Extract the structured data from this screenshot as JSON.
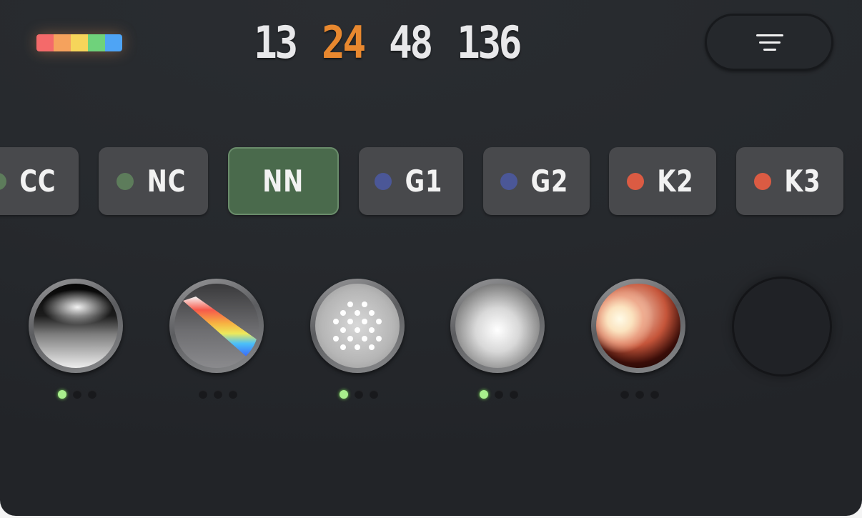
{
  "colors": {
    "accent": "#e8882f",
    "active_chip": "#4a6a4c",
    "indicator_on": "#a9f08d"
  },
  "logo": {
    "icon": "rainbow-bar-icon",
    "colors": [
      "#f46a6a",
      "#f5a25d",
      "#f6d55a",
      "#6fd27b",
      "#4ea4f5"
    ]
  },
  "numbers": {
    "values": [
      "13",
      "24",
      "48",
      "136"
    ],
    "selected": "24"
  },
  "menu": {
    "icon": "menu-icon"
  },
  "chips": [
    {
      "label": "CC",
      "dot_color": "#5d7c5b",
      "selected": false
    },
    {
      "label": "NC",
      "dot_color": "#5d7c5b",
      "selected": false
    },
    {
      "label": "NN",
      "dot_color": null,
      "selected": true
    },
    {
      "label": "G1",
      "dot_color": "#4b5797",
      "selected": false
    },
    {
      "label": "G2",
      "dot_color": "#4b5797",
      "selected": false
    },
    {
      "label": "K2",
      "dot_color": "#db5b43",
      "selected": false
    },
    {
      "label": "K3",
      "dot_color": "#db5b43",
      "selected": false
    }
  ],
  "materials": [
    {
      "name": "chrome-ball",
      "indicator": [
        true,
        false,
        false
      ]
    },
    {
      "name": "prism-ball",
      "indicator": [
        false,
        false,
        false
      ]
    },
    {
      "name": "dots-ball",
      "indicator": [
        true,
        false,
        false
      ]
    },
    {
      "name": "soft-light-ball",
      "indicator": [
        true,
        false,
        false
      ]
    },
    {
      "name": "warm-glow-ball",
      "indicator": [
        false,
        false,
        false
      ]
    },
    {
      "name": "empty-slot",
      "indicator": null
    }
  ]
}
